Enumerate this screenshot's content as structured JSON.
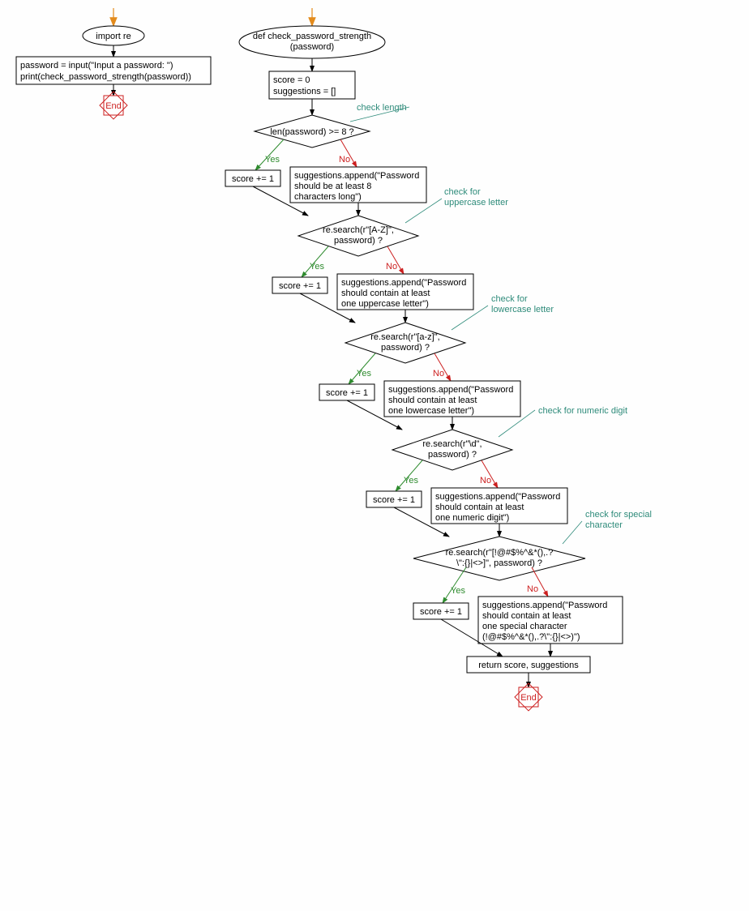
{
  "left": {
    "entry_arrow": true,
    "import": "import re",
    "body": "password = input(\"Input a password: \")\nprint(check_password_strength(password))",
    "end": "End"
  },
  "right": {
    "entry_arrow": true,
    "def": "def check_password_strength\n(password)",
    "init": "score = 0\nsuggestions = []",
    "end": "End",
    "branch_labels": {
      "yes": "Yes",
      "no": "No"
    },
    "checks": [
      {
        "comment": "check length",
        "cond": "len(password) >= 8 ?",
        "yes": "score += 1",
        "no": "suggestions.append(\"Password\nshould be at least 8\ncharacters long\")"
      },
      {
        "comment": "check for\nuppercase letter",
        "cond": "re.search(r\"[A-Z]\",\npassword) ?",
        "yes": "score += 1",
        "no": "suggestions.append(\"Password\nshould contain at least\none uppercase letter\")"
      },
      {
        "comment": "check for\nlowercase letter",
        "cond": "re.search(r\"[a-z]\",\npassword) ?",
        "yes": "score += 1",
        "no": "suggestions.append(\"Password\nshould contain at least\none lowercase letter\")"
      },
      {
        "comment": "check for numeric digit",
        "cond": "re.search(r\"\\d\",\npassword) ?",
        "yes": "score += 1",
        "no": "suggestions.append(\"Password\nshould contain at least\none numeric digit\")"
      },
      {
        "comment": "check for special\ncharacter",
        "cond": "re.search(r\"[!@#$%^&*(),.?\n\\\":{}|<>]\", password) ?",
        "yes": "score += 1",
        "no": "suggestions.append(\"Password\nshould contain at least\none special character\n(!@#$%^&*(),.?\\\":{}|<>)\")"
      }
    ],
    "return": "return score, suggestions"
  }
}
